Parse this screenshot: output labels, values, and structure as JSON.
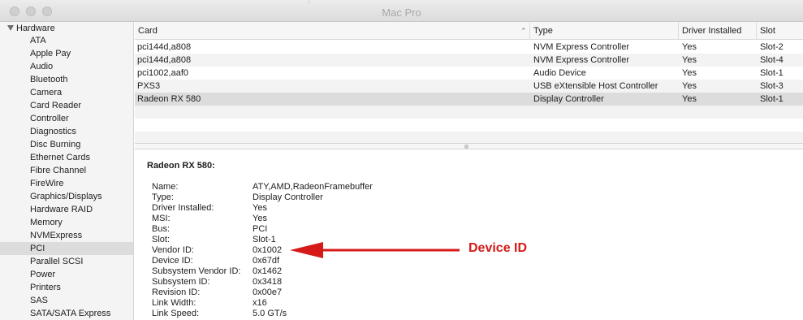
{
  "window": {
    "title": "Mac Pro"
  },
  "sidebar": {
    "header": "Hardware",
    "items": [
      {
        "label": "ATA"
      },
      {
        "label": "Apple Pay"
      },
      {
        "label": "Audio"
      },
      {
        "label": "Bluetooth"
      },
      {
        "label": "Camera"
      },
      {
        "label": "Card Reader"
      },
      {
        "label": "Controller"
      },
      {
        "label": "Diagnostics"
      },
      {
        "label": "Disc Burning"
      },
      {
        "label": "Ethernet Cards"
      },
      {
        "label": "Fibre Channel"
      },
      {
        "label": "FireWire"
      },
      {
        "label": "Graphics/Displays"
      },
      {
        "label": "Hardware RAID"
      },
      {
        "label": "Memory"
      },
      {
        "label": "NVMExpress"
      },
      {
        "label": "PCI",
        "selected": true
      },
      {
        "label": "Parallel SCSI"
      },
      {
        "label": "Power"
      },
      {
        "label": "Printers"
      },
      {
        "label": "SAS"
      },
      {
        "label": "SATA/SATA Express"
      }
    ]
  },
  "table": {
    "columns": [
      "Card",
      "Type",
      "Driver Installed",
      "Slot"
    ],
    "rows": [
      {
        "card": "pci144d,a808",
        "type": "NVM Express Controller",
        "driver": "Yes",
        "slot": "Slot-2"
      },
      {
        "card": "pci144d,a808",
        "type": "NVM Express Controller",
        "driver": "Yes",
        "slot": "Slot-4"
      },
      {
        "card": "pci1002,aaf0",
        "type": "Audio Device",
        "driver": "Yes",
        "slot": "Slot-1"
      },
      {
        "card": "PXS3",
        "type": "USB eXtensible Host Controller",
        "driver": "Yes",
        "slot": "Slot-3"
      },
      {
        "card": "Radeon RX 580",
        "type": "Display Controller",
        "driver": "Yes",
        "slot": "Slot-1",
        "selected": true
      }
    ]
  },
  "detail": {
    "title": "Radeon RX 580:",
    "properties": [
      {
        "label": "Name:",
        "value": "ATY,AMD,RadeonFramebuffer"
      },
      {
        "label": "Type:",
        "value": "Display Controller"
      },
      {
        "label": "Driver Installed:",
        "value": "Yes"
      },
      {
        "label": "MSI:",
        "value": "Yes"
      },
      {
        "label": "Bus:",
        "value": "PCI"
      },
      {
        "label": "Slot:",
        "value": "Slot-1"
      },
      {
        "label": "Vendor ID:",
        "value": "0x1002"
      },
      {
        "label": "Device ID:",
        "value": "0x67df"
      },
      {
        "label": "Subsystem Vendor ID:",
        "value": "0x1462"
      },
      {
        "label": "Subsystem ID:",
        "value": "0x3418"
      },
      {
        "label": "Revision ID:",
        "value": "0x00e7"
      },
      {
        "label": "Link Width:",
        "value": "x16"
      },
      {
        "label": "Link Speed:",
        "value": "5.0 GT/s"
      }
    ]
  },
  "annotation": {
    "label": "Device ID",
    "color": "#d61919"
  }
}
